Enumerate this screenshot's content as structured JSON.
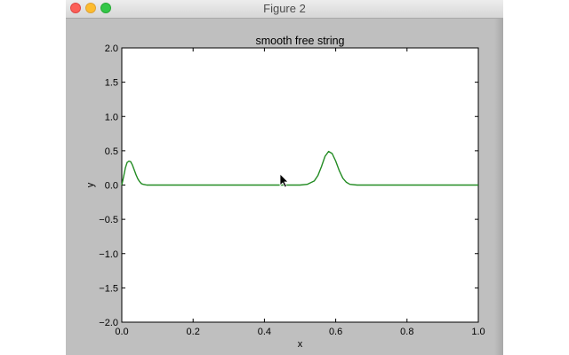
{
  "window": {
    "title": "Figure 2"
  },
  "colors": {
    "line": "#228b22",
    "figure_bg": "#bfbfbf",
    "axes_bg": "#ffffff"
  },
  "chart_data": {
    "type": "line",
    "title": "smooth free string",
    "xlabel": "x",
    "ylabel": "y",
    "xlim": [
      0.0,
      1.0
    ],
    "ylim": [
      -2.0,
      2.0
    ],
    "grid": false,
    "xticks": [
      "0.0",
      "0.2",
      "0.4",
      "0.6",
      "0.8",
      "1.0"
    ],
    "yticks": [
      "2.0",
      "1.5",
      "1.0",
      "0.5",
      "0.0",
      "−0.5",
      "−1.0",
      "−1.5",
      "−2.0"
    ],
    "series": [
      {
        "x": [
          0.0,
          0.005,
          0.01,
          0.015,
          0.02,
          0.025,
          0.03,
          0.035,
          0.04,
          0.045,
          0.05,
          0.055,
          0.06,
          0.065,
          0.07,
          0.08,
          0.1,
          0.2,
          0.3,
          0.4,
          0.45,
          0.5,
          0.52,
          0.54,
          0.55,
          0.56,
          0.57,
          0.58,
          0.59,
          0.6,
          0.61,
          0.62,
          0.63,
          0.64,
          0.66,
          0.7,
          0.8,
          0.9,
          1.0
        ],
        "y": [
          0.0,
          0.12,
          0.25,
          0.33,
          0.35,
          0.34,
          0.29,
          0.22,
          0.15,
          0.09,
          0.05,
          0.02,
          0.01,
          0.005,
          0.0,
          0.0,
          0.0,
          0.0,
          0.0,
          0.0,
          0.0,
          0.0,
          0.01,
          0.06,
          0.14,
          0.27,
          0.42,
          0.49,
          0.46,
          0.35,
          0.21,
          0.1,
          0.04,
          0.01,
          0.0,
          0.0,
          0.0,
          0.0,
          0.0
        ]
      }
    ]
  }
}
